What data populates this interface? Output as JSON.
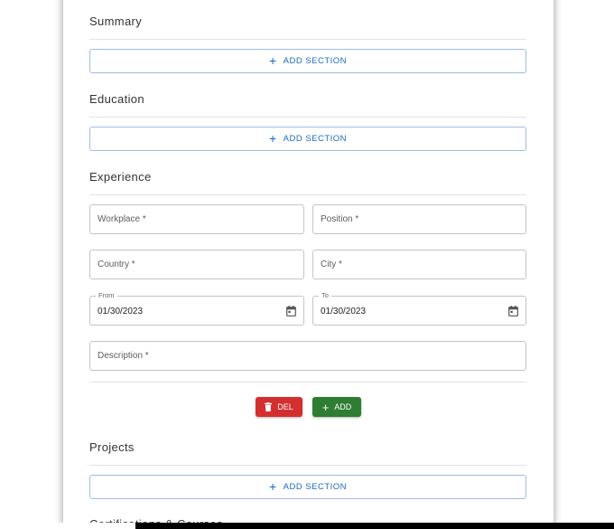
{
  "sections": {
    "summary": {
      "title": "Summary",
      "add_label": "ADD SECTION"
    },
    "education": {
      "title": "Education",
      "add_label": "ADD SECTION"
    },
    "experience": {
      "title": "Experience",
      "fields": {
        "workplace": {
          "placeholder": "Workplace *"
        },
        "position": {
          "placeholder": "Position *"
        },
        "country": {
          "placeholder": "Country *"
        },
        "city": {
          "placeholder": "City *"
        },
        "from": {
          "label": "From",
          "value": "01/30/2023"
        },
        "to": {
          "label": "To",
          "value": "01/30/2023"
        },
        "description": {
          "placeholder": "Description *"
        }
      },
      "del_label": "DEL",
      "add_label": "ADD"
    },
    "projects": {
      "title": "Projects",
      "add_label": "ADD SECTION"
    },
    "certifications": {
      "title": "Certifications & Courses"
    }
  },
  "colors": {
    "accent_blue": "#1a6bc1",
    "delete_red": "#d32f2f",
    "add_green": "#2e7d32"
  },
  "icons": {
    "add_section": "plus-icon",
    "date_picker": "calendar-icon",
    "delete": "trash-icon",
    "add": "plus-icon"
  }
}
